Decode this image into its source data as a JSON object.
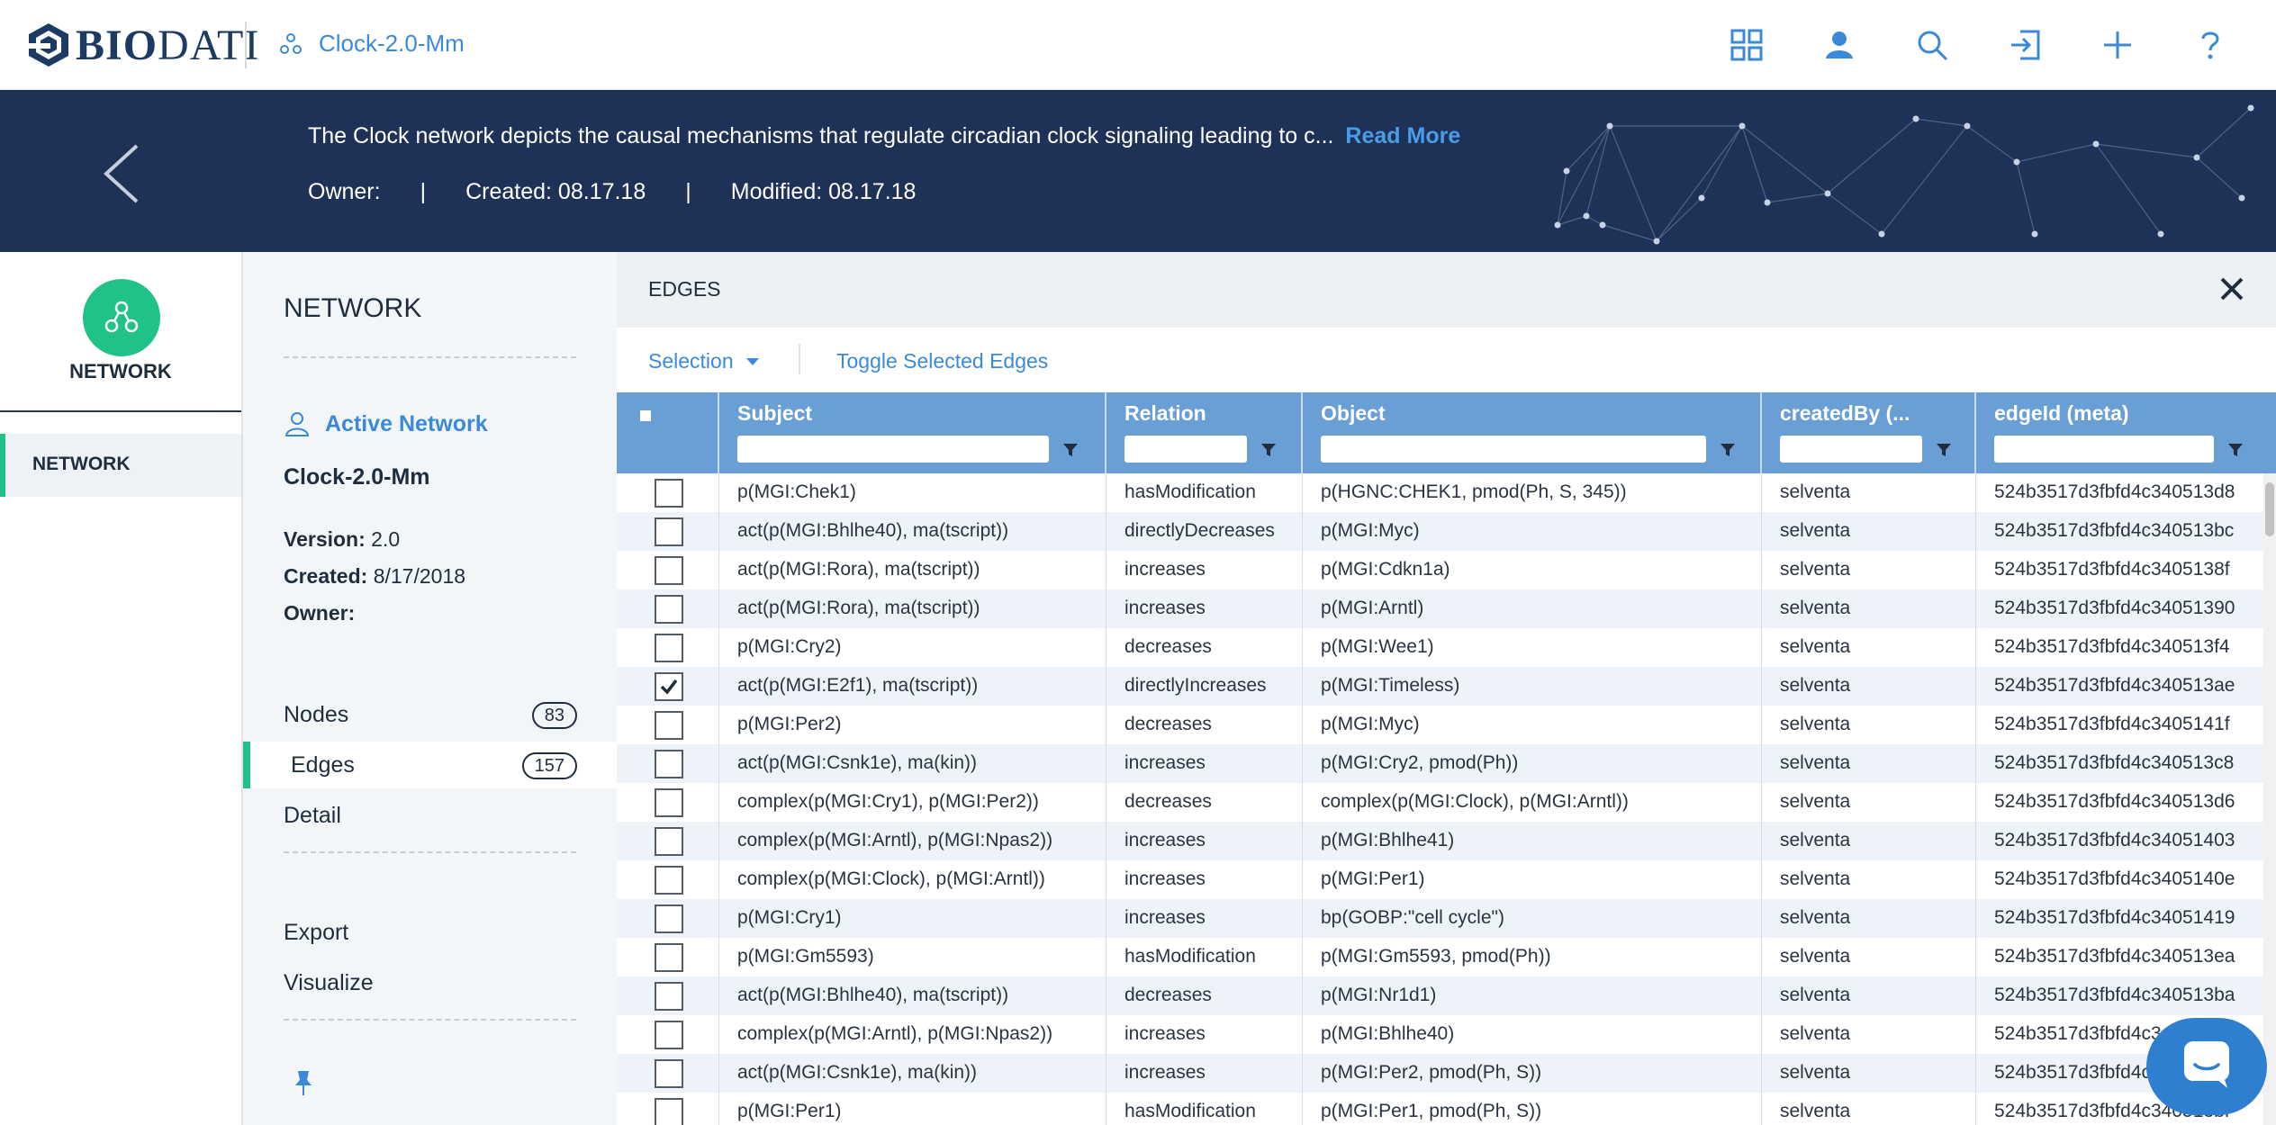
{
  "app": {
    "logo_text_bold": "BIO",
    "logo_text_rest": "DATI",
    "network_name": "Clock-2.0-Mm",
    "top_icons": [
      "grid-icon",
      "user-icon",
      "search-icon",
      "login-icon",
      "plus-icon",
      "help-icon"
    ],
    "colors": {
      "accent": "#3b8ad9",
      "brand_navy": "#1e3257",
      "green": "#21c288",
      "table_header": "#6a9fd6"
    }
  },
  "banner": {
    "description": "The Clock network depicts the causal mechanisms that regulate circadian clock signaling leading to c...",
    "read_more": "Read More",
    "owner": "Owner:",
    "sep1": "|",
    "created": "Created: 08.17.18",
    "sep2": "|",
    "modified": "Modified: 08.17.18"
  },
  "rail": {
    "title": "NETWORK",
    "item": "NETWORK"
  },
  "panel": {
    "title": "NETWORK",
    "active_network": "Active Network",
    "network_name": "Clock-2.0-Mm",
    "version_label": "Version:",
    "version_value": "2.0",
    "created_label": "Created:",
    "created_value": "8/17/2018",
    "owner_label": "Owner:",
    "nav": [
      {
        "label": "Nodes",
        "count": "83"
      },
      {
        "label": "Edges",
        "count": "157"
      },
      {
        "label": "Detail"
      }
    ],
    "export": "Export",
    "visualize": "Visualize"
  },
  "edges": {
    "title": "EDGES",
    "selection": "Selection",
    "toggle": "Toggle Selected Edges",
    "columns": [
      "Subject",
      "Relation",
      "Object",
      "createdBy (...",
      "edgeId (meta)"
    ],
    "header_checkbox": "■",
    "rows": [
      {
        "checked": false,
        "subject": "p(MGI:Chek1)",
        "relation": "hasModification",
        "object": "p(HGNC:CHEK1, pmod(Ph, S, 345))",
        "createdBy": "selventa",
        "edgeId": "524b3517d3fbfd4c340513d8"
      },
      {
        "checked": false,
        "subject": "act(p(MGI:Bhlhe40), ma(tscript))",
        "relation": "directlyDecreases",
        "object": "p(MGI:Myc)",
        "createdBy": "selventa",
        "edgeId": "524b3517d3fbfd4c340513bc"
      },
      {
        "checked": false,
        "subject": "act(p(MGI:Rora), ma(tscript))",
        "relation": "increases",
        "object": "p(MGI:Cdkn1a)",
        "createdBy": "selventa",
        "edgeId": "524b3517d3fbfd4c3405138f"
      },
      {
        "checked": false,
        "subject": "act(p(MGI:Rora), ma(tscript))",
        "relation": "increases",
        "object": "p(MGI:Arntl)",
        "createdBy": "selventa",
        "edgeId": "524b3517d3fbfd4c34051390"
      },
      {
        "checked": false,
        "subject": "p(MGI:Cry2)",
        "relation": "decreases",
        "object": "p(MGI:Wee1)",
        "createdBy": "selventa",
        "edgeId": "524b3517d3fbfd4c340513f4"
      },
      {
        "checked": true,
        "subject": "act(p(MGI:E2f1), ma(tscript))",
        "relation": "directlyIncreases",
        "object": "p(MGI:Timeless)",
        "createdBy": "selventa",
        "edgeId": "524b3517d3fbfd4c340513ae"
      },
      {
        "checked": false,
        "subject": "p(MGI:Per2)",
        "relation": "decreases",
        "object": "p(MGI:Myc)",
        "createdBy": "selventa",
        "edgeId": "524b3517d3fbfd4c3405141f"
      },
      {
        "checked": false,
        "subject": "act(p(MGI:Csnk1e), ma(kin))",
        "relation": "increases",
        "object": "p(MGI:Cry2, pmod(Ph))",
        "createdBy": "selventa",
        "edgeId": "524b3517d3fbfd4c340513c8"
      },
      {
        "checked": false,
        "subject": "complex(p(MGI:Cry1), p(MGI:Per2))",
        "relation": "decreases",
        "object": "complex(p(MGI:Clock), p(MGI:Arntl))",
        "createdBy": "selventa",
        "edgeId": "524b3517d3fbfd4c340513d6"
      },
      {
        "checked": false,
        "subject": "complex(p(MGI:Arntl), p(MGI:Npas2))",
        "relation": "increases",
        "object": "p(MGI:Bhlhe41)",
        "createdBy": "selventa",
        "edgeId": "524b3517d3fbfd4c34051403"
      },
      {
        "checked": false,
        "subject": "complex(p(MGI:Clock), p(MGI:Arntl))",
        "relation": "increases",
        "object": "p(MGI:Per1)",
        "createdBy": "selventa",
        "edgeId": "524b3517d3fbfd4c3405140e"
      },
      {
        "checked": false,
        "subject": "p(MGI:Cry1)",
        "relation": "increases",
        "object": "bp(GOBP:\"cell cycle\")",
        "createdBy": "selventa",
        "edgeId": "524b3517d3fbfd4c34051419"
      },
      {
        "checked": false,
        "subject": "p(MGI:Gm5593)",
        "relation": "hasModification",
        "object": "p(MGI:Gm5593, pmod(Ph))",
        "createdBy": "selventa",
        "edgeId": "524b3517d3fbfd4c340513ea"
      },
      {
        "checked": false,
        "subject": "act(p(MGI:Bhlhe40), ma(tscript))",
        "relation": "decreases",
        "object": "p(MGI:Nr1d1)",
        "createdBy": "selventa",
        "edgeId": "524b3517d3fbfd4c340513ba"
      },
      {
        "checked": false,
        "subject": "complex(p(MGI:Arntl), p(MGI:Npas2))",
        "relation": "increases",
        "object": "p(MGI:Bhlhe40)",
        "createdBy": "selventa",
        "edgeId": "524b3517d3fbfd4c34051405"
      },
      {
        "checked": false,
        "subject": "act(p(MGI:Csnk1e), ma(kin))",
        "relation": "increases",
        "object": "p(MGI:Per2, pmod(Ph, S))",
        "createdBy": "selventa",
        "edgeId": "524b3517d3fbfd4c340513c4"
      },
      {
        "checked": false,
        "subject": "p(MGI:Per1)",
        "relation": "hasModification",
        "object": "p(MGI:Per1, pmod(Ph, S))",
        "createdBy": "selventa",
        "edgeId": "524b3517d3fbfd4c340513bf"
      }
    ]
  }
}
